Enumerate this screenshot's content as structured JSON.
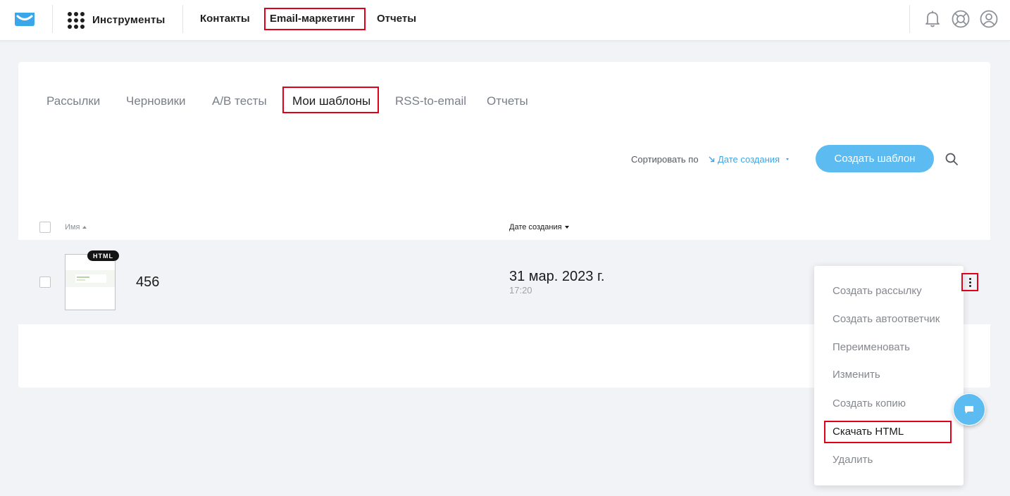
{
  "topbar": {
    "tools_label": "Инструменты",
    "nav": [
      "Контакты",
      "Email-маркетинг",
      "Отчеты"
    ]
  },
  "tabs": [
    "Рассылки",
    "Черновики",
    "A/B тесты",
    "Мои шаблоны",
    "RSS-to-email",
    "Отчеты"
  ],
  "toolbar": {
    "sort_label": "Сортировать по",
    "sort_value": "Дате создания",
    "create_label": "Создать шаблон"
  },
  "table": {
    "columns": [
      "Имя",
      "Дате создания"
    ],
    "rows": [
      {
        "badge": "HTML",
        "name": "456",
        "date": "31 мар. 2023 г.",
        "time": "17:20"
      }
    ]
  },
  "row_menu": [
    "Создать рассылку",
    "Создать автоответчик",
    "Переименовать",
    "Изменить",
    "Создать копию",
    "Скачать HTML",
    "Удалить"
  ],
  "colors": {
    "accent": "#5cbcf2",
    "link": "#3aa7ea",
    "highlight": "#e0001a"
  }
}
